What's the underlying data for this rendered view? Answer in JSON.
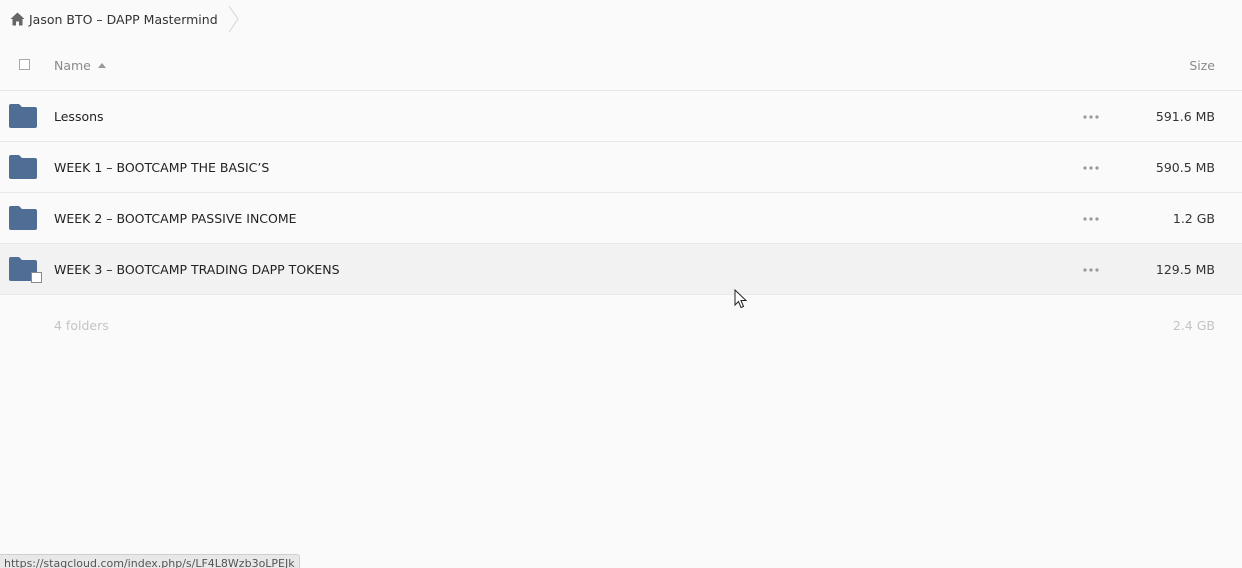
{
  "breadcrumb": {
    "home_icon": "home-icon",
    "label": "Jason BTO – DAPP Mastermind"
  },
  "table": {
    "header": {
      "name_label": "Name",
      "size_label": "Size",
      "sort_icon": "sort-ascending-icon"
    },
    "rows": [
      {
        "name": "Lessons",
        "size": "591.6 MB",
        "icon": "folder-icon"
      },
      {
        "name": "WEEK 1 – BOOTCAMP THE BASIC’S",
        "size": "590.5 MB",
        "icon": "folder-icon"
      },
      {
        "name": "WEEK 2 – BOOTCAMP PASSIVE INCOME",
        "size": "1.2 GB",
        "icon": "folder-icon"
      },
      {
        "name": "WEEK 3 – BOOTCAMP TRADING DAPP TOKENS",
        "size": "129.5 MB",
        "icon": "folder-icon"
      }
    ],
    "summary": {
      "count": "4 folders",
      "total_size": "2.4 GB"
    }
  },
  "status_bar": {
    "url": "https://stagcloud.com/index.php/s/LF4L8Wzb3oLPEJk"
  },
  "colors": {
    "folder": "#4f6d95",
    "background": "#fafafa",
    "hover_row": "#f2f2f2"
  }
}
